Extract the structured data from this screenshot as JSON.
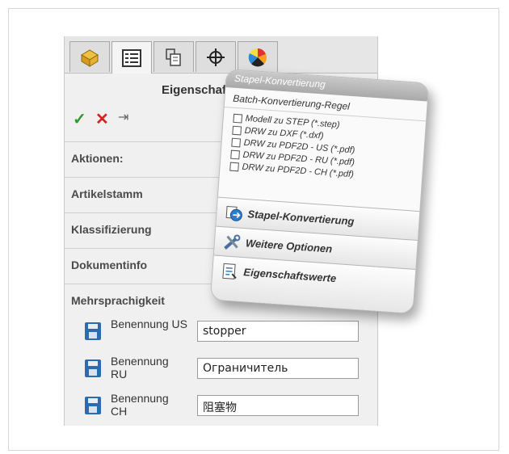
{
  "panel": {
    "title": "Eigenschaften",
    "tabs": [
      {
        "icon": "feature-manager-icon"
      },
      {
        "icon": "property-manager-icon"
      },
      {
        "icon": "configuration-manager-icon"
      },
      {
        "icon": "dimxpert-icon"
      },
      {
        "icon": "display-manager-icon"
      }
    ],
    "actions": {
      "ok": "✓",
      "cancel": "✕",
      "pin": "⇥"
    },
    "sections": [
      {
        "label": "Aktionen:"
      },
      {
        "label": "Artikelstamm"
      },
      {
        "label": "Klassifizierung"
      },
      {
        "label": "Dokumentinfo"
      },
      {
        "label": "Mehrsprachigkeit"
      }
    ],
    "fields": [
      {
        "label": "Benennung US",
        "value": "stopper"
      },
      {
        "label": "Benennung RU",
        "value": "Ограничитель"
      },
      {
        "label": "Benennung CH",
        "value": "阻塞物"
      }
    ]
  },
  "card": {
    "header": "Stapel-Konvertierung",
    "subtitle": "Batch-Konvertierung-Regel",
    "checkboxes": [
      "Modell zu STEP (*.step)",
      "DRW zu DXF (*.dxf)",
      "DRW zu PDF2D - US (*.pdf)",
      "DRW zu PDF2D - RU (*.pdf)",
      "DRW zu PDF2D - CH (*.pdf)"
    ],
    "buttons": [
      {
        "label": "Stapel-Konvertierung",
        "icon": "batch-convert-icon"
      },
      {
        "label": "Weitere Optionen",
        "icon": "tools-icon"
      },
      {
        "label": "Eigenschaftswerte",
        "icon": "properties-icon"
      }
    ]
  },
  "colors": {
    "ok": "#2e9a2e",
    "cancel": "#d62222",
    "save": "#2b6bb0"
  }
}
